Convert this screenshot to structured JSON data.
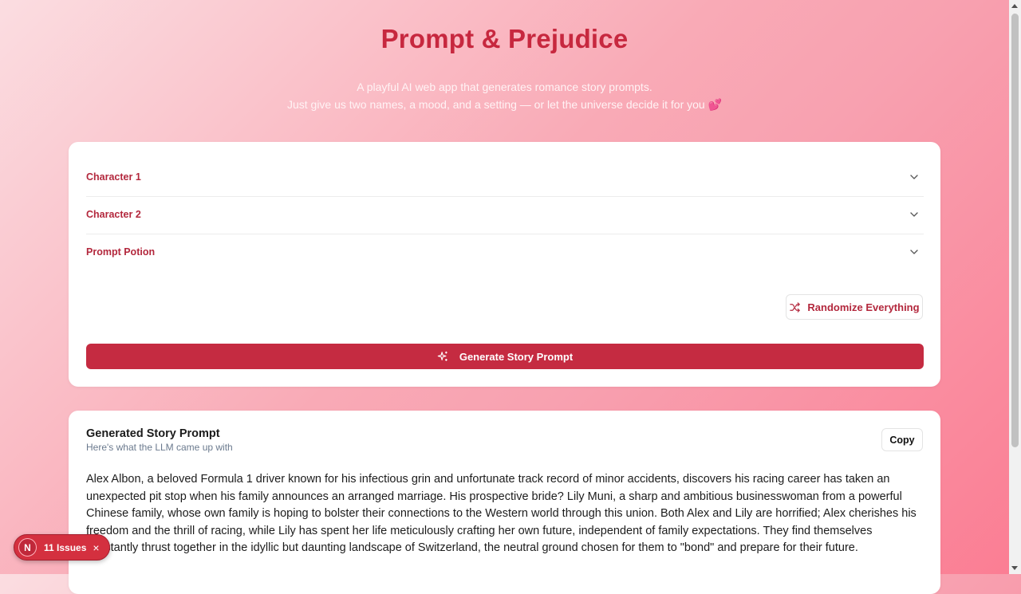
{
  "header": {
    "title": "Prompt & Prejudice",
    "subtitle_line1": "A playful AI web app that generates romance story prompts.",
    "subtitle_line2": "Just give us two names, a mood, and a setting — or let the universe decide it for you 💕"
  },
  "form": {
    "accordion": [
      {
        "label": "Character 1",
        "icon": "chevron-down-icon"
      },
      {
        "label": "Character 2",
        "icon": "chevron-down-icon"
      },
      {
        "label": "Prompt Potion",
        "icon": "chevron-down-icon"
      }
    ],
    "randomize_label": "Randomize Everything",
    "generate_label": "Generate Story Prompt"
  },
  "result": {
    "title": "Generated Story Prompt",
    "subtitle": "Here's what the LLM came up with",
    "copy_label": "Copy",
    "story": "Alex Albon, a beloved Formula 1 driver known for his infectious grin and unfortunate track record of minor accidents, discovers his racing career has taken an unexpected pit stop when his family announces an arranged marriage. His prospective bride? Lily Muni, a sharp and ambitious businesswoman from a powerful Chinese family, whose own family is hoping to bolster their connections to the Western world through this union. Both Alex and Lily are horrified; Alex cherishes his freedom and the thrill of racing, while Lily has spent her life meticulously crafting her own future, independent of family expectations. They find themselves constantly thrust together in the idyllic but daunting landscape of Switzerland, the neutral ground chosen for them to \"bond\" and prepare for their future."
  },
  "dev_overlay": {
    "logo": "N",
    "issues_label": "11 Issues",
    "close": "×"
  },
  "colors": {
    "accent": "#c52b41",
    "title": "#c7283f"
  }
}
